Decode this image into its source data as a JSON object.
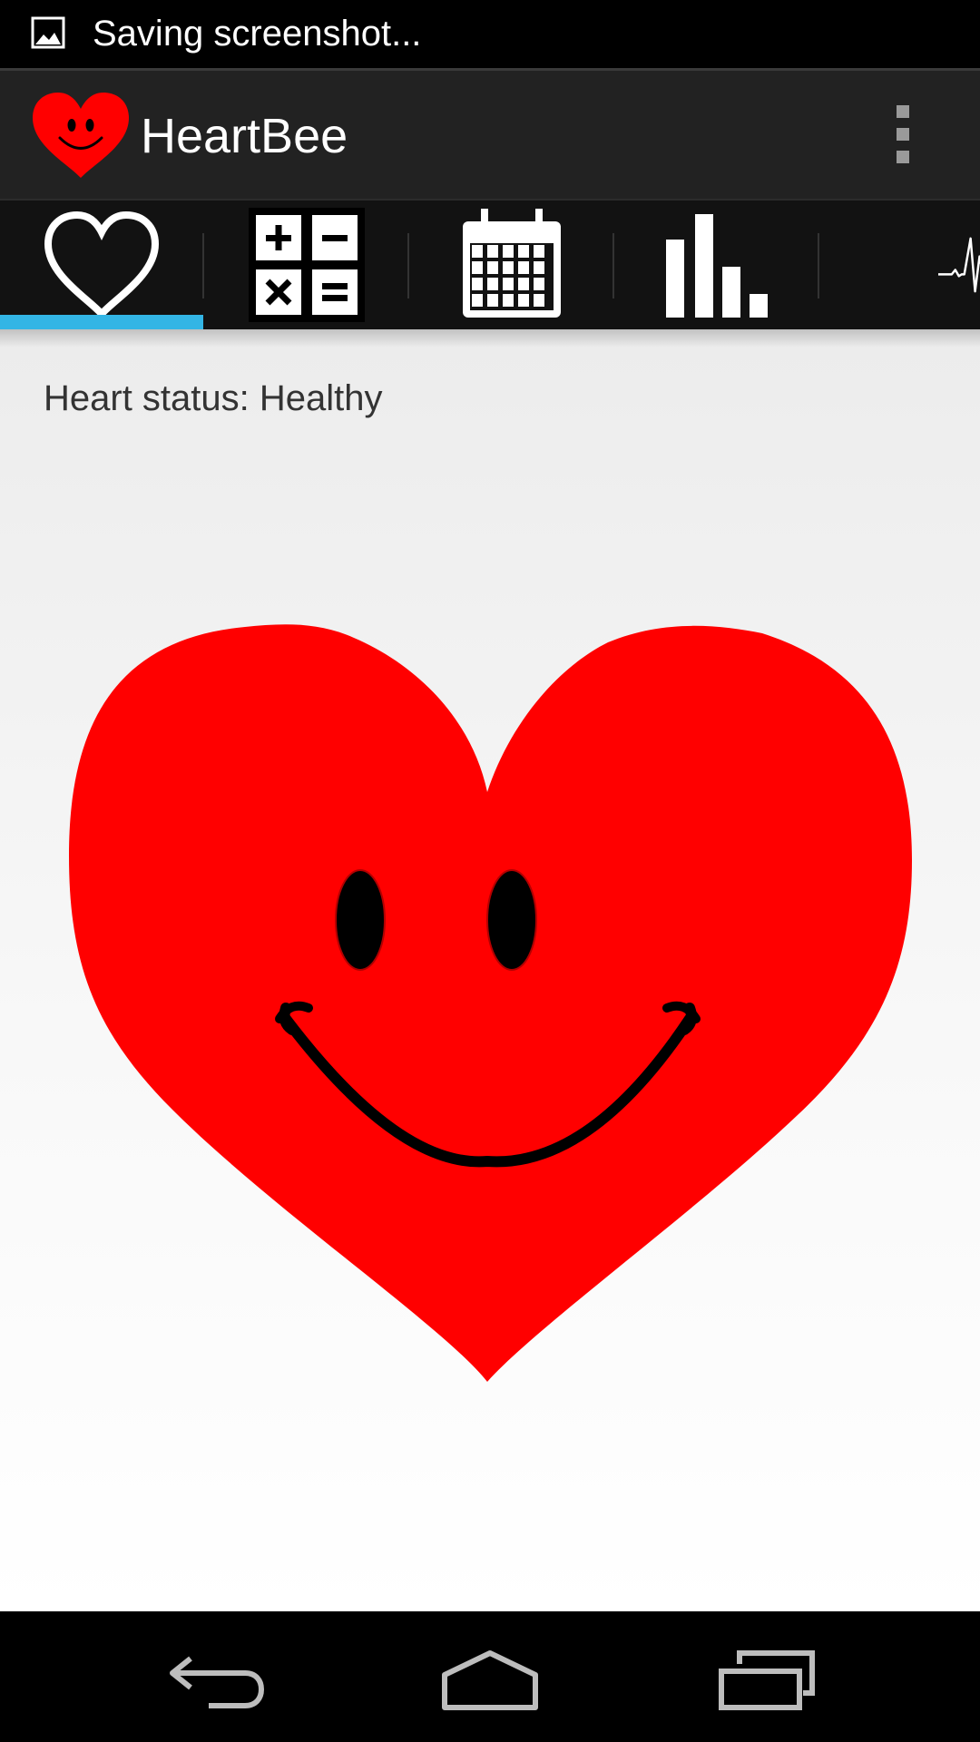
{
  "status_bar": {
    "notification_icon": "image-icon",
    "text": "Saving screenshot..."
  },
  "action_bar": {
    "app_icon": "smiley-heart-icon",
    "title": "HeartBee",
    "overflow_icon": "overflow-menu-icon"
  },
  "tabs": [
    {
      "icon": "heart-outline-icon",
      "selected": true
    },
    {
      "icon": "calculator-icon",
      "selected": false
    },
    {
      "icon": "calendar-icon",
      "selected": false
    },
    {
      "icon": "bar-chart-icon",
      "selected": false
    },
    {
      "icon": "heartbeat-pulse-icon",
      "selected": false
    }
  ],
  "main": {
    "status_label": "Heart status: Healthy",
    "heart_image": "smiley-heart-icon"
  },
  "nav_bar": {
    "back_icon": "back-icon",
    "home_icon": "home-icon",
    "recents_icon": "recent-apps-icon"
  },
  "colors": {
    "accent": "#33b5e5",
    "heart": "#ff0000",
    "action_bar": "#222222",
    "tab_bar": "#121212"
  }
}
